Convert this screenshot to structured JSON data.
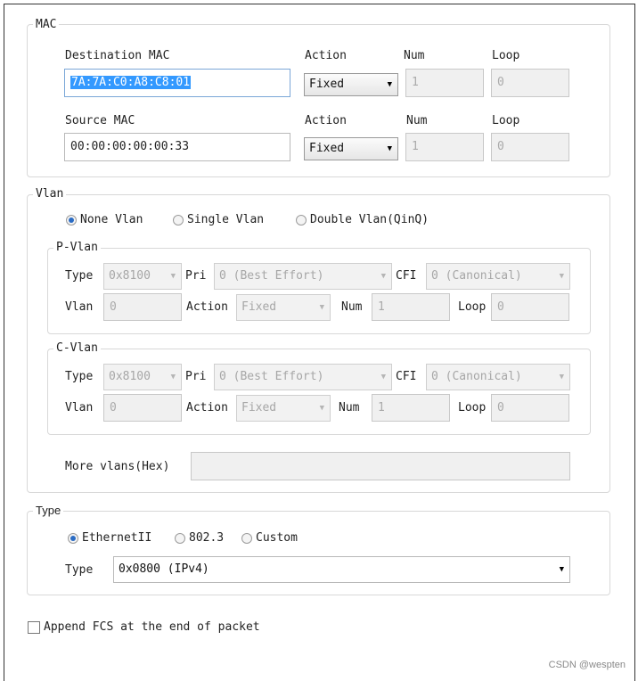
{
  "mac": {
    "title": "MAC",
    "destination": {
      "label": "Destination MAC",
      "value": "7A:7A:C0:A8:C8:01",
      "action_label": "Action",
      "action_value": "Fixed",
      "num_label": "Num",
      "num_value": "1",
      "loop_label": "Loop",
      "loop_value": "0"
    },
    "source": {
      "label": "Source MAC",
      "value": "00:00:00:00:00:33",
      "action_label": "Action",
      "action_value": "Fixed",
      "num_label": "Num",
      "num_value": "1",
      "loop_label": "Loop",
      "loop_value": "0"
    }
  },
  "vlan": {
    "title": "Vlan",
    "options": [
      "None Vlan",
      "Single Vlan",
      "Double Vlan(QinQ)"
    ],
    "selected": "None Vlan",
    "p_vlan": {
      "title": "P-Vlan",
      "type_label": "Type",
      "type_value": "0x8100",
      "pri_label": "Pri",
      "pri_value": "0 (Best Effort)",
      "cfi_label": "CFI",
      "cfi_value": "0 (Canonical)",
      "vlan_label": "Vlan",
      "vlan_value": "0",
      "action_label": "Action",
      "action_value": "Fixed",
      "num_label": "Num",
      "num_value": "1",
      "loop_label": "Loop",
      "loop_value": "0"
    },
    "c_vlan": {
      "title": "C-Vlan",
      "type_label": "Type",
      "type_value": "0x8100",
      "pri_label": "Pri",
      "pri_value": "0 (Best Effort)",
      "cfi_label": "CFI",
      "cfi_value": "0 (Canonical)",
      "vlan_label": "Vlan",
      "vlan_value": "0",
      "action_label": "Action",
      "action_value": "Fixed",
      "num_label": "Num",
      "num_value": "1",
      "loop_label": "Loop",
      "loop_value": "0"
    },
    "more_label": "More vlans(Hex)",
    "more_value": ""
  },
  "type": {
    "title": "Type",
    "options": [
      "EthernetII",
      "802.3",
      "Custom"
    ],
    "selected": "EthernetII",
    "type_label": "Type",
    "type_value": "0x0800 (IPv4)"
  },
  "fcs": {
    "label": "Append FCS at the end of packet",
    "checked": false
  },
  "watermark": "CSDN @wespten",
  "icons": {
    "dropdown": "chevron-down-icon"
  }
}
